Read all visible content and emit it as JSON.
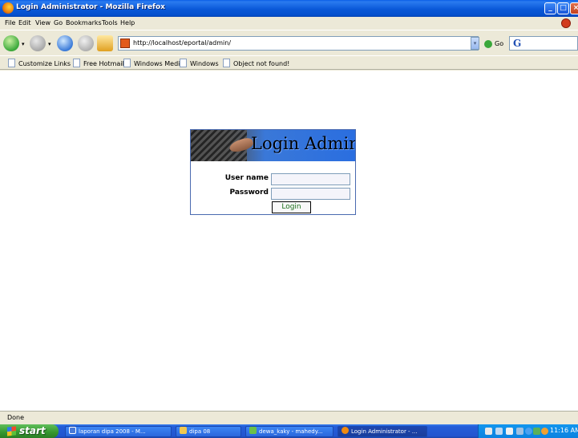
{
  "window": {
    "title": "Login Administrator - Mozilla Firefox",
    "controls": {
      "minimize": "_",
      "maximize": "□",
      "close": "×"
    }
  },
  "menu": [
    "File",
    "Edit",
    "View",
    "Go",
    "Bookmarks",
    "Tools",
    "Help"
  ],
  "nav": {
    "url": "http://localhost/eportal/admin/",
    "go_label": "Go",
    "search_logo": "G"
  },
  "bookmarks": [
    "Customize Links",
    "Free Hotmail",
    "Windows Media",
    "Windows",
    "Object not found!"
  ],
  "login": {
    "title": "Login Admin",
    "username_label": "User name",
    "password_label": "Password",
    "button_label": "Login",
    "username_value": "",
    "password_value": ""
  },
  "status": {
    "text": "Done"
  },
  "taskbar": {
    "start_label": "start",
    "tasks": [
      "laporan dipa 2008 - M...",
      "dipa 08",
      "dewa_kaky - mahedy...",
      "Login Administrator - ..."
    ],
    "clock": "11:16 AM"
  },
  "colors": {
    "titlebar": "#0a58d8",
    "taskbar": "#2255d0",
    "start_button": "#35962f",
    "login_button_text": "#1a6e1a"
  }
}
